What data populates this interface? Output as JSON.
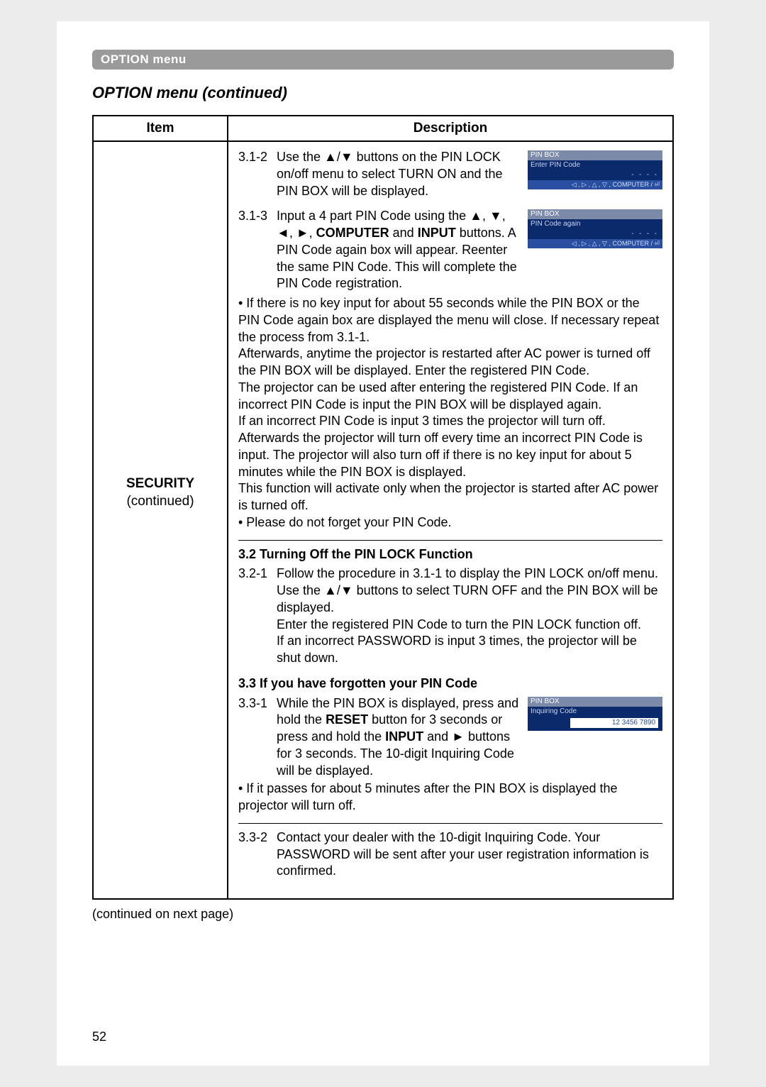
{
  "tab_label": "OPTION menu",
  "section_title": "OPTION menu (continued)",
  "table": {
    "headers": {
      "item": "Item",
      "description": "Description"
    },
    "item": {
      "name": "SECURITY",
      "sub": "(continued)"
    }
  },
  "osd": {
    "enter": {
      "title": "PIN BOX",
      "sub": "Enter PIN Code",
      "dashes": "- - - -",
      "foot": "◁ , ▷ , △ , ▽ , COMPUTER / ⏎"
    },
    "again": {
      "title": "PIN BOX",
      "sub": "PIN Code again",
      "dashes": "- - - -",
      "foot": "◁ , ▷ , △ , ▽ , COMPUTER / ⏎"
    },
    "inquiring": {
      "title": "PIN BOX",
      "sub": "Inquiring Code",
      "digits": "12 3456 7890"
    }
  },
  "p312_num": "3.1-2",
  "p312_a": "Use the ▲/▼ buttons on the PIN LOCK on/off menu to select TURN ON and the PIN BOX will be displayed.",
  "p313_num": "3.1-3",
  "p313_a": "Input a 4 part PIN Code using the ▲, ▼, ◄, ►, ",
  "p313_bold1": "COMPUTER",
  "p313_mid": " and ",
  "p313_bold2": "INPUT",
  "p313_b": " buttons. A PIN Code again box will appear. Reenter the same PIN Code. This will complete the PIN Code registration.",
  "p313_note1": "• If there is no key input for about 55 seconds while the PIN BOX or the PIN Code again box are displayed the menu will close. If necessary repeat the process from 3.1-1.",
  "p313_after1": "Afterwards, anytime the projector is restarted after AC power is turned off the PIN BOX will be displayed. Enter the registered PIN Code.",
  "p313_after2": "The projector can be used after entering the registered PIN Code. If an incorrect PIN Code is input the PIN BOX will be displayed again.",
  "p313_after3": "If an incorrect PIN Code is input 3 times the projector will turn off. Afterwards the projector will turn off every time an incorrect PIN Code is input. The projector will also turn off if there is no key input for about 5 minutes while the PIN BOX is displayed.",
  "p313_after4": "This function will activate only when the projector is started after AC power is turned off.",
  "p313_note2": "• Please do not forget your PIN Code.",
  "h32": "3.2 Turning Off the PIN LOCK Function",
  "p321_num": "3.2-1",
  "p321_a": "Follow the procedure in 3.1-1 to display the PIN LOCK on/off menu. Use the ▲/▼ buttons to select TURN OFF and the PIN BOX will be displayed.",
  "p321_b": "Enter the registered PIN Code to turn the PIN LOCK function off.",
  "p321_c": "If an incorrect PASSWORD is input 3 times, the projector will be shut down.",
  "h33": "3.3 If you have forgotten your PIN Code",
  "p331_num": "3.3-1",
  "p331_a": "While the PIN BOX is displayed, press and hold the ",
  "p331_bold1": "RESET",
  "p331_b": " button for 3 seconds or press and hold the ",
  "p331_bold2": "INPUT",
  "p331_c": " and ► buttons for 3 seconds. The 10-digit Inquiring Code will be displayed.",
  "p331_note": "• If it passes for about 5 minutes after the PIN BOX is displayed the projector will turn off.",
  "p332_num": "3.3-2",
  "p332_a": "Contact your dealer with the 10-digit Inquiring Code. Your PASSWORD will be sent after your user registration information is confirmed.",
  "continued": "(continued on next page)",
  "page_number": "52"
}
